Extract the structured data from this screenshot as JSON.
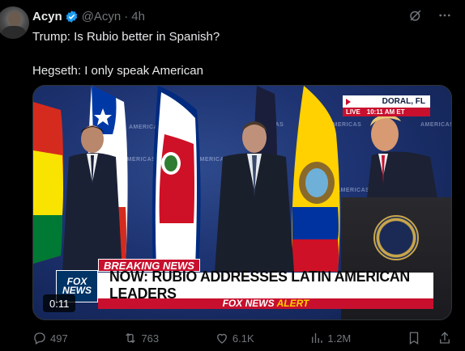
{
  "tweet": {
    "author_name": "Acyn",
    "handle": "@Acyn",
    "separator": "·",
    "time": "4h",
    "text_line1": "Trump: Is Rubio better in Spanish?",
    "text_line2": "Hegseth: I only speak American"
  },
  "media": {
    "location": "DORAL, FL",
    "live_label": "LIVE",
    "live_time": "10:11 AM ET",
    "banner_breaking": "BREAKING NEWS",
    "headline": "NOW: RUBIO ADDRESSES LATIN AMERICAN LEADERS",
    "alert_brand": "FOX NEWS",
    "alert_word": "ALERT",
    "network_logo_line1": "FOX",
    "network_logo_line2": "NEWS",
    "backdrop_logo": "AMERICAS",
    "video_time": "0:11"
  },
  "actions": {
    "replies": "497",
    "reposts": "763",
    "likes": "6.1K",
    "views": "1.2M"
  },
  "colors": {
    "background": "#000000",
    "text_primary": "#e7e9ea",
    "text_secondary": "#71767b",
    "verified": "#1d9bf0",
    "fox_red": "#c8102e",
    "fox_blue": "#003366"
  },
  "icons": {
    "verified": "verified-badge-icon",
    "grok": "grok-icon",
    "more": "more-icon",
    "reply": "reply-icon",
    "repost": "repost-icon",
    "like": "heart-icon",
    "views": "views-icon",
    "bookmark": "bookmark-icon",
    "share": "share-icon"
  }
}
